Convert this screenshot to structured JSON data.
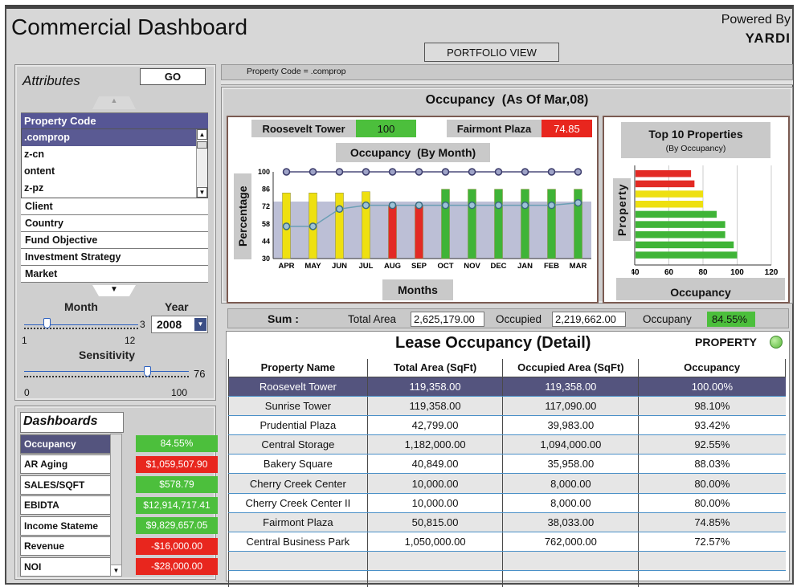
{
  "header": {
    "title": "Commercial Dashboard",
    "powered_by": "Powered By",
    "brand": "YARDI",
    "view_button": "PORTFOLIO VIEW"
  },
  "attributes": {
    "title": "Attributes",
    "go_label": "GO"
  },
  "attr_list": {
    "header": "Property Code",
    "options": [
      ".comprop",
      "z-cn",
      "ontent",
      "z-pz"
    ],
    "items": [
      "Client",
      "Country",
      "Fund Objective",
      "Investment Strategy",
      "Market"
    ]
  },
  "filters": {
    "month_label": "Month",
    "year_label": "Year",
    "month_value": "3",
    "year_value": "2008",
    "month_min": "1",
    "month_max": "12",
    "month_level": 3,
    "sensitivity_label": "Sensitivity",
    "sens_value": "76",
    "sens_min": "0",
    "sens_max": "100",
    "sens_level": 76
  },
  "dashboards": {
    "title": "Dashboards",
    "items": [
      {
        "name": "Occupancy",
        "value": "84.55%",
        "status": "green",
        "selected": true
      },
      {
        "name": "AR Aging",
        "value": "$1,059,507.90",
        "status": "red"
      },
      {
        "name": "SALES/SQFT",
        "value": "$578.79",
        "status": "green"
      },
      {
        "name": "EBIDTA",
        "value": "$12,914,717.41",
        "status": "green"
      },
      {
        "name": "Income Stateme",
        "value": "$9,829,657.05",
        "status": "green"
      },
      {
        "name": "Revenue",
        "value": "-$16,000.00",
        "status": "red"
      },
      {
        "name": "NOI",
        "value": "-$28,000.00",
        "status": "red"
      }
    ]
  },
  "main": {
    "property_code": "Property Code = .comprop",
    "occupancy_title": "Occupancy  (As Of Mar,08)",
    "top_prop": {
      "name": "Roosevelt Tower",
      "value": "100"
    },
    "low_prop": {
      "name": "Fairmont Plaza",
      "value": "74.85"
    }
  },
  "summary": {
    "sum_label": "Sum :",
    "total_area_label": "Total Area",
    "total_area": "2,625,179.00",
    "occupied_label": "Occupied",
    "occupied": "2,219,662.00",
    "occupancy_label": "Occupany",
    "occupancy": "84.55%"
  },
  "detail": {
    "title": "Lease Occupancy (Detail)",
    "toggle_label": "PROPERTY",
    "columns": [
      "Property Name",
      "Total Area (SqFt)",
      "Occupied Area (SqFt)",
      "Occupancy"
    ],
    "rows": [
      [
        "Roosevelt Tower",
        "119,358.00",
        "119,358.00",
        "100.00%"
      ],
      [
        "Sunrise Tower",
        "119,358.00",
        "117,090.00",
        "98.10%"
      ],
      [
        "Prudential Plaza",
        "42,799.00",
        "39,983.00",
        "93.42%"
      ],
      [
        "Central Storage",
        "1,182,000.00",
        "1,094,000.00",
        "92.55%"
      ],
      [
        "Bakery Square",
        "40,849.00",
        "35,958.00",
        "88.03%"
      ],
      [
        "Cherry Creek Center",
        "10,000.00",
        "8,000.00",
        "80.00%"
      ],
      [
        "Cherry Creek Center II",
        "10,000.00",
        "8,000.00",
        "80.00%"
      ],
      [
        "Fairmont Plaza",
        "50,815.00",
        "38,033.00",
        "74.85%"
      ],
      [
        "Central Business Park",
        "1,050,000.00",
        "762,000.00",
        "72.57%"
      ],
      [
        "",
        "",
        "",
        ""
      ],
      [
        "",
        "",
        "",
        ""
      ]
    ]
  },
  "colors": {
    "green": "#4cbf3c",
    "red": "#e8261e",
    "yellow": "#f0e400",
    "selection": "#54547e"
  },
  "chart_data": [
    {
      "type": "bar",
      "title": "Occupancy  (By Month)",
      "xlabel": "Months",
      "ylabel": "Percentage",
      "categories": [
        "APR",
        "MAY",
        "JUN",
        "JUL",
        "AUG",
        "SEP",
        "OCT",
        "NOV",
        "DEC",
        "JAN",
        "FEB",
        "MAR"
      ],
      "yticks": [
        30,
        44,
        58,
        72,
        86,
        100
      ],
      "ylim": [
        30,
        100
      ],
      "series": [
        {
          "values": [
            83,
            83,
            83,
            84,
            73,
            73,
            86,
            86,
            86,
            86,
            86,
            86
          ],
          "colors": [
            "yellow",
            "yellow",
            "yellow",
            "yellow",
            "red",
            "red",
            "green",
            "green",
            "green",
            "green",
            "green",
            "green"
          ]
        },
        {
          "values": [
            100,
            100,
            100,
            100,
            100,
            100,
            100,
            100,
            100,
            100,
            100,
            100
          ],
          "kind": "line"
        },
        {
          "values": [
            56,
            56,
            70,
            73,
            73,
            73,
            73,
            73,
            73,
            73,
            73,
            75
          ],
          "kind": "line"
        }
      ],
      "band": [
        30,
        76
      ]
    },
    {
      "type": "bar",
      "orientation": "horizontal",
      "title": "Top 10 Properties",
      "subtitle": "(By Occupancy)",
      "xlabel": "Occupancy",
      "ylabel": "Property",
      "xticks": [
        40,
        60,
        80,
        100,
        120
      ],
      "xlim": [
        40,
        120
      ],
      "values": [
        73,
        75,
        80,
        80,
        88,
        93,
        93,
        98,
        100
      ],
      "colors": [
        "red",
        "red",
        "yellow",
        "yellow",
        "green",
        "green",
        "green",
        "green",
        "green"
      ]
    }
  ]
}
